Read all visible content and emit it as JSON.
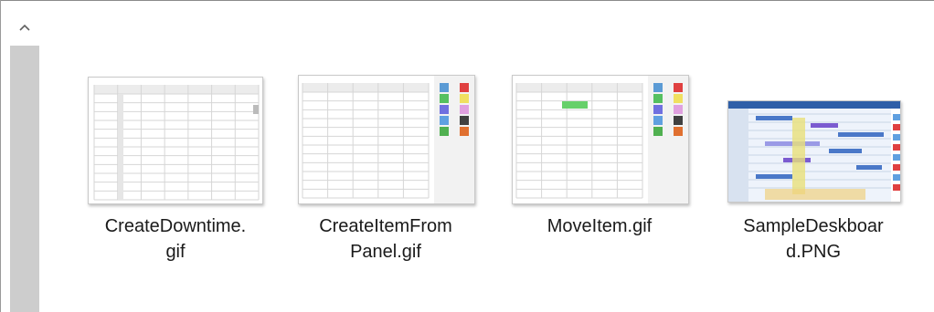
{
  "files": [
    {
      "name_line1": "CreateDowntime.",
      "name_line2": "gif",
      "thumb_icon": "grid-thumbnail"
    },
    {
      "name_line1": "CreateItemFrom",
      "name_line2": "Panel.gif",
      "thumb_icon": "grid-palette-thumbnail"
    },
    {
      "name_line1": "MoveItem.gif",
      "name_line2": "",
      "thumb_icon": "grid-palette-move-thumbnail"
    },
    {
      "name_line1": "SampleDeskboar",
      "name_line2": "d.PNG",
      "thumb_icon": "dashboard-screenshot-thumbnail"
    }
  ],
  "scrollbar": {
    "up_icon": "chevron-up-icon"
  },
  "colors": {
    "thumb_border": "#c9c9c9",
    "grid_line": "#d6d6d6",
    "palette": [
      "#5b9bd5",
      "#e04040",
      "#55c060",
      "#f0e060",
      "#7070e0",
      "#e0a0e0",
      "#60a0e0",
      "#404040",
      "#50b050",
      "#e07030"
    ],
    "scroll_thumb": "#cdcdcd"
  }
}
